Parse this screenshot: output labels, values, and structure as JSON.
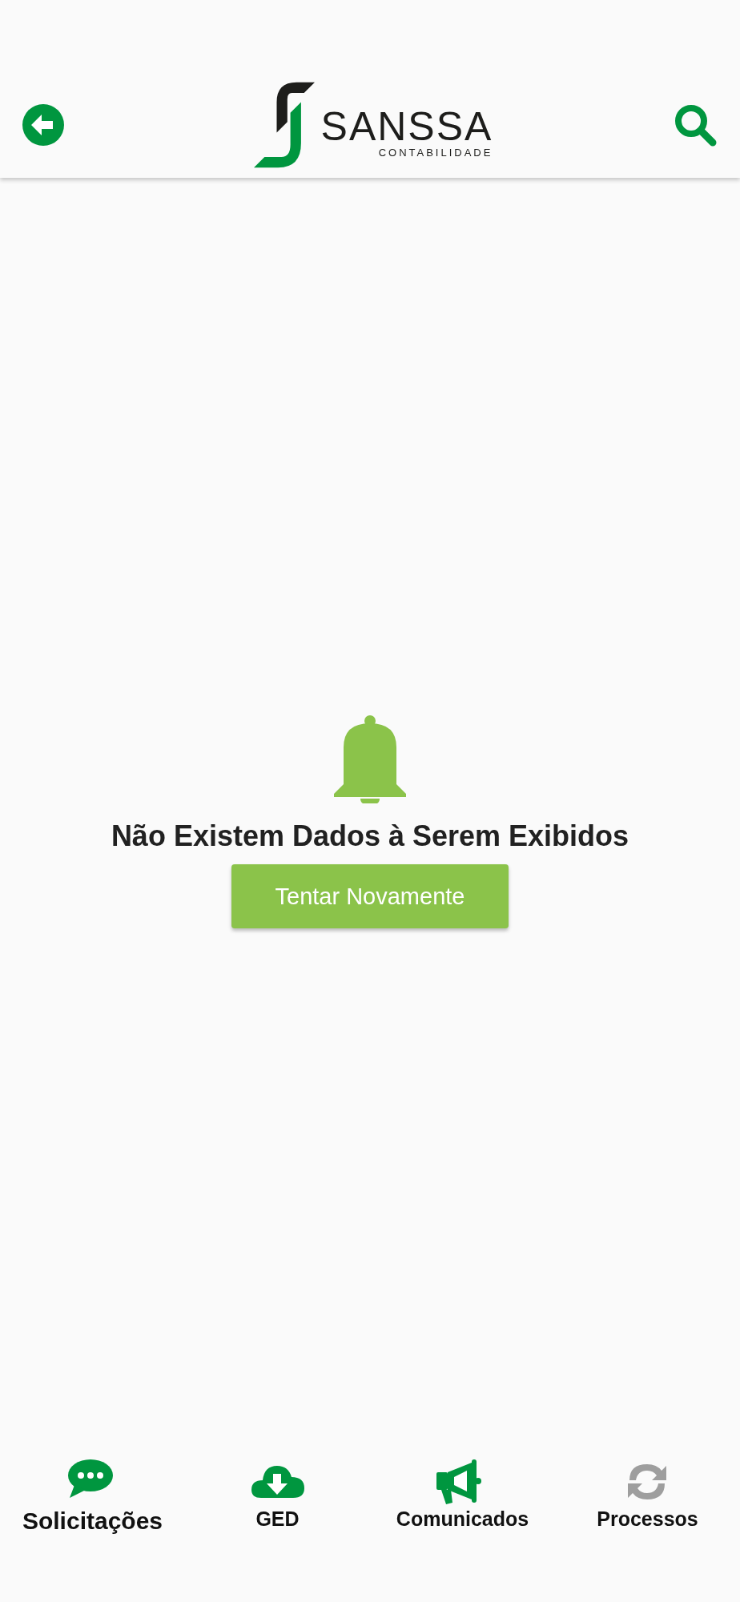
{
  "header": {
    "logo": {
      "name": "SANSSA",
      "tagline": "CONTABILIDADE"
    }
  },
  "empty_state": {
    "message": "Não Existem Dados à Serem Exibidos",
    "button": "Tentar Novamente"
  },
  "bottom_nav": [
    {
      "kind": "chat",
      "label": "Solicitações",
      "selected": true,
      "disabled": false
    },
    {
      "kind": "cloud",
      "label": "GED",
      "selected": false,
      "disabled": false
    },
    {
      "kind": "megaphone",
      "label": "Comunicados",
      "selected": false,
      "disabled": false
    },
    {
      "kind": "sync",
      "label": "Processos",
      "selected": false,
      "disabled": true
    }
  ]
}
